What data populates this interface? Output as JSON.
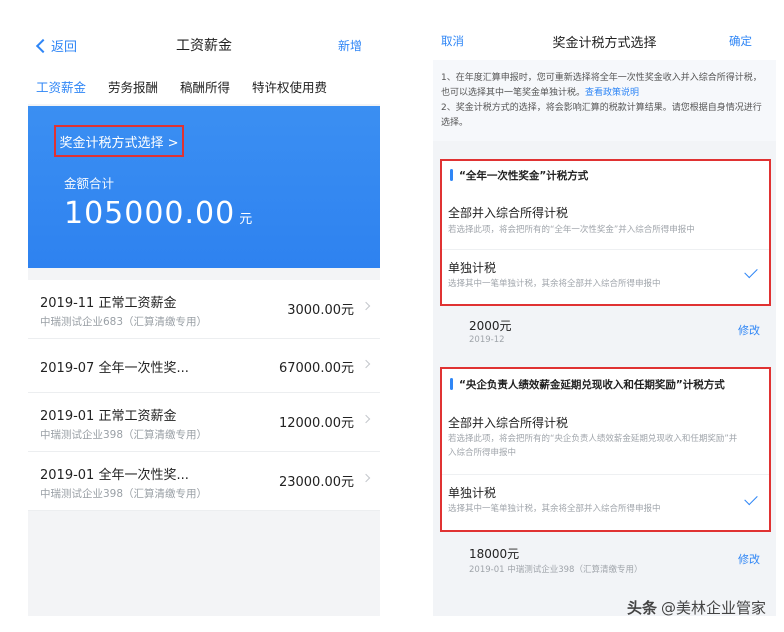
{
  "left": {
    "nav": {
      "back": "返回",
      "title": "工资薪金",
      "add": "新增"
    },
    "tabs": [
      "工资薪金",
      "劳务报酬",
      "稿酬所得",
      "特许权使用费"
    ],
    "banner": {
      "select_label": "奖金计税方式选择 >",
      "sum_label": "金额合计",
      "amount": "105000.00",
      "unit": "元"
    },
    "items": [
      {
        "title": "2019-11 正常工资薪金",
        "sub": "中瑞测试企业683（汇算清缴专用）",
        "value": "3000.00元"
      },
      {
        "title": "2019-07 全年一次性奖...",
        "sub": "",
        "value": "67000.00元"
      },
      {
        "title": "2019-01 正常工资薪金",
        "sub": "中瑞测试企业398（汇算清缴专用）",
        "value": "12000.00元"
      },
      {
        "title": "2019-01 全年一次性奖...",
        "sub": "中瑞测试企业398（汇算清缴专用）",
        "value": "23000.00元"
      }
    ]
  },
  "right": {
    "nav": {
      "cancel": "取消",
      "title": "奖金计税方式选择",
      "confirm": "确定"
    },
    "notice": {
      "line1": "1、在年度汇算申报时，您可重新选择将全年一次性奖金收入并入综合所得计税，也可以选择其中一笔奖金单独计税。",
      "link": "查看政策说明",
      "line2": "2、奖金计税方式的选择，将会影响汇算的税款计算结果。请您根据自身情况进行选择。"
    },
    "section1": {
      "title": "“全年一次性奖金”计税方式",
      "opt1_title": "全部并入综合所得计税",
      "opt1_desc": "若选择此项，将会把所有的“全年一次性奖金”并入综合所得申报中",
      "opt2_title": "单独计税",
      "opt2_desc": "选择其中一笔单独计税，其余将全部并入综合所得申报中"
    },
    "amount1": {
      "value": "2000元",
      "date": "2019-12",
      "edit": "修改"
    },
    "section2": {
      "title": "“央企负责人绩效薪金延期兑现收入和任期奖励”计税方式",
      "opt1_title": "全部并入综合所得计税",
      "opt1_desc": "若选择此项，将会把所有的“央企负责人绩效薪金延期兑现收入和任期奖励”并入综合所得申报中",
      "opt2_title": "单独计税",
      "opt2_desc": "选择其中一笔单独计税，其余将全部并入综合所得申报中"
    },
    "amount2": {
      "value": "18000元",
      "date": "2019-01 中瑞测试企业398（汇算清缴专用）",
      "edit": "修改"
    }
  },
  "watermark": {
    "brand": "头条",
    "text": "@美林企业管家"
  },
  "colors": {
    "accent": "#2f86f6",
    "highlight": "#e03232"
  }
}
